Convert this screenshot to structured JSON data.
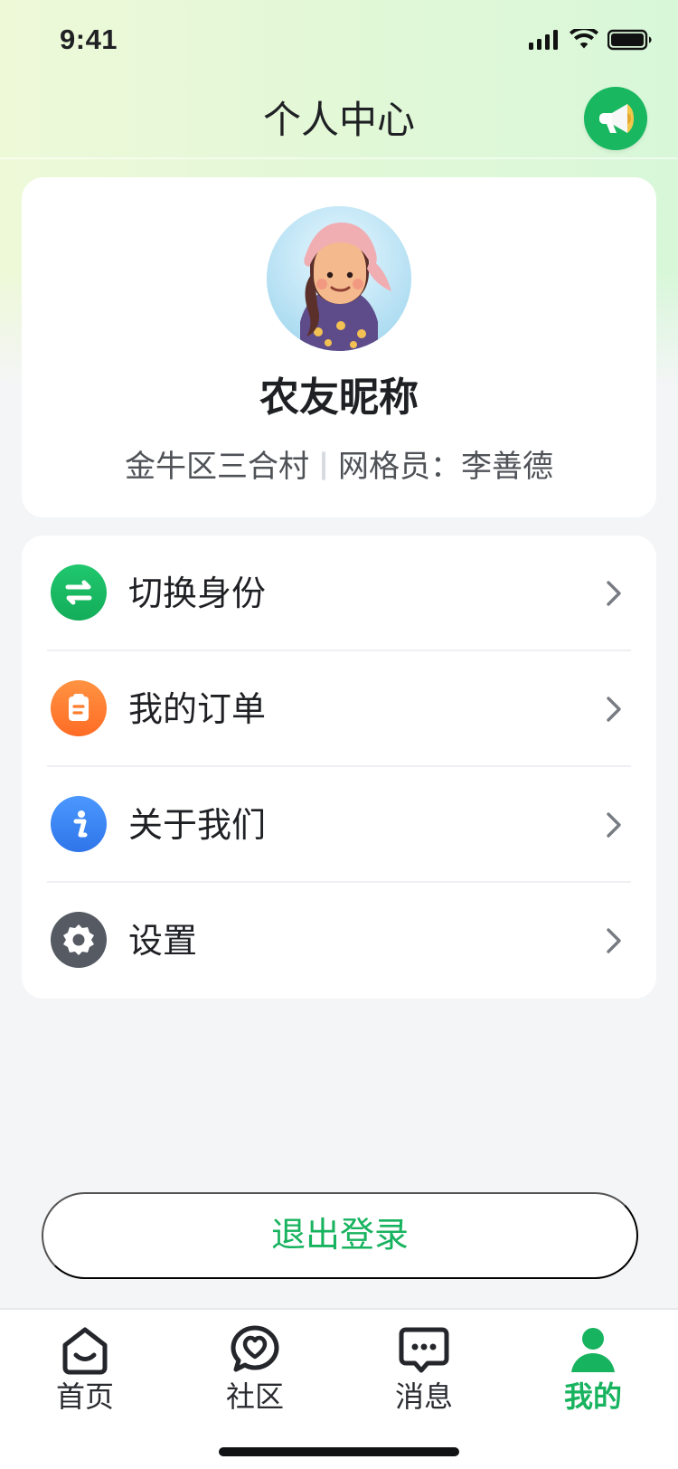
{
  "status_bar": {
    "time": "9:41"
  },
  "header": {
    "title": "个人中心",
    "announce_icon": "megaphone-icon"
  },
  "profile": {
    "nickname": "农友昵称",
    "location": "金牛区三合村",
    "grid_worker_label": "网格员：",
    "grid_worker_name": "李善德"
  },
  "menu": {
    "items": [
      {
        "label": "切换身份",
        "icon": "switch-arrows-icon",
        "color": "#17b45d"
      },
      {
        "label": "我的订单",
        "icon": "clipboard-icon",
        "color": "#ff7d2d"
      },
      {
        "label": "关于我们",
        "icon": "info-icon",
        "color": "#3d86f2"
      },
      {
        "label": "设置",
        "icon": "gear-icon",
        "color": "#525760"
      }
    ]
  },
  "logout": {
    "label": "退出登录"
  },
  "tabbar": {
    "items": [
      {
        "label": "首页",
        "icon": "home-icon"
      },
      {
        "label": "社区",
        "icon": "community-heart-icon"
      },
      {
        "label": "消息",
        "icon": "message-icon"
      },
      {
        "label": "我的",
        "icon": "profile-icon",
        "active": true
      }
    ]
  },
  "colors": {
    "brand_green": "#18b35f",
    "page_background": "#f4f5f7",
    "header_gradient_start": "#eef9d8",
    "header_gradient_end": "#d8f7d9"
  }
}
